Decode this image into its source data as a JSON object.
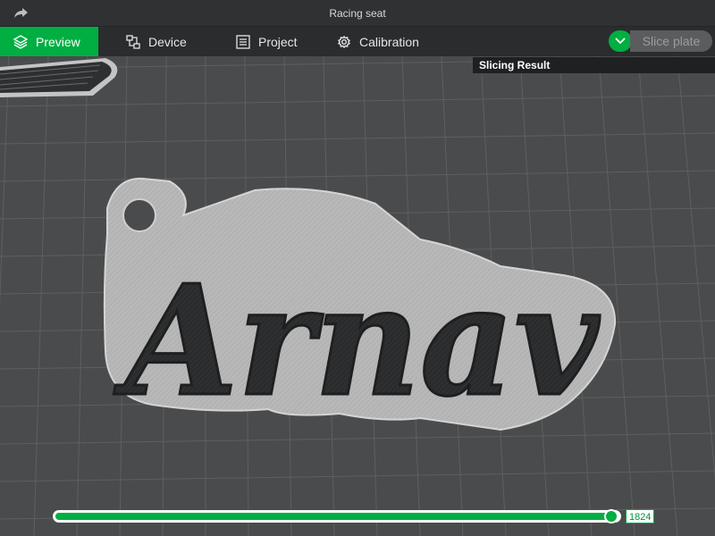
{
  "window": {
    "title": "Racing seat"
  },
  "tabs": {
    "preview": "Preview",
    "device": "Device",
    "project": "Project",
    "calibration": "Calibration"
  },
  "toolbar": {
    "slice_plate": "Slice plate"
  },
  "panel": {
    "slicing_result": "Slicing Result"
  },
  "model": {
    "text": "Arnav"
  },
  "layer_slider": {
    "value_label": "1824",
    "position": 1.0
  },
  "colors": {
    "accent": "#00ae42",
    "plate": "#4a4b4c",
    "grid": "#5e5f60",
    "model_fill": "#2a2b2c",
    "model_outline": "#b9b9b9"
  },
  "icons": {
    "share": "share-arrow-icon",
    "preview": "layers-icon",
    "device": "device-icon",
    "project": "project-list-icon",
    "calibration": "calibration-gear-icon",
    "slice_toggle": "chevron-down-icon"
  }
}
